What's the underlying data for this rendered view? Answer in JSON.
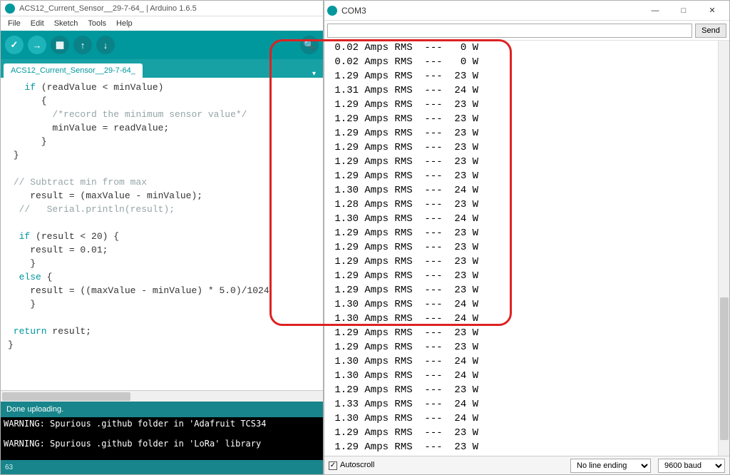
{
  "ide": {
    "title": "ACS12_Current_Sensor__29-7-64_ | Arduino 1.6.5",
    "menu": [
      "File",
      "Edit",
      "Sketch",
      "Tools",
      "Help"
    ],
    "tab": "ACS12_Current_Sensor__29-7-64_",
    "code": {
      "l1a": "   if",
      "l1b": " (readValue < minValue)",
      "l2": "      {",
      "l3a": "        ",
      "l3b": "/*record the minimum sensor value*/",
      "l4": "        minValue = readValue;",
      "l5": "      }",
      "l6": " }",
      "l7": "",
      "l8a": " ",
      "l8b": "// Subtract min from max",
      "l9": "    result = (maxValue - minValue);",
      "l10a": "  ",
      "l10b": "//   Serial.println(result);",
      "l11": "",
      "l12a": "  if",
      "l12b": " (result < 20) {",
      "l13": "    result = 0.01;",
      "l14": "    }",
      "l15a": "  else",
      "l15b": " {",
      "l16": "    result = ((maxValue - minValue) * 5.0)/1024",
      "l17": "    }",
      "l18": "",
      "l19a": " return",
      "l19b": " result;",
      "l20": "}"
    },
    "status": "Done uploading.",
    "console_l1": "WARNING: Spurious .github folder in 'Adafruit TCS34",
    "console_l2": "",
    "console_l3": "WARNING: Spurious .github folder in 'LoRa' library",
    "footer": "63"
  },
  "serial": {
    "port": "COM3",
    "send": "Send",
    "input_value": "",
    "autoscroll": "Autoscroll",
    "line_ending": "No line ending",
    "baud": "9600 baud",
    "lines": [
      " 0.02 Amps RMS  ---   0 W",
      " 0.02 Amps RMS  ---   0 W",
      " 1.29 Amps RMS  ---  23 W",
      " 1.31 Amps RMS  ---  24 W",
      " 1.29 Amps RMS  ---  23 W",
      " 1.29 Amps RMS  ---  23 W",
      " 1.29 Amps RMS  ---  23 W",
      " 1.29 Amps RMS  ---  23 W",
      " 1.29 Amps RMS  ---  23 W",
      " 1.29 Amps RMS  ---  23 W",
      " 1.30 Amps RMS  ---  24 W",
      " 1.28 Amps RMS  ---  23 W",
      " 1.30 Amps RMS  ---  24 W",
      " 1.29 Amps RMS  ---  23 W",
      " 1.29 Amps RMS  ---  23 W",
      " 1.29 Amps RMS  ---  23 W",
      " 1.29 Amps RMS  ---  23 W",
      " 1.29 Amps RMS  ---  23 W",
      " 1.30 Amps RMS  ---  24 W",
      " 1.30 Amps RMS  ---  24 W",
      " 1.29 Amps RMS  ---  23 W",
      " 1.29 Amps RMS  ---  23 W",
      " 1.30 Amps RMS  ---  24 W",
      " 1.30 Amps RMS  ---  24 W",
      " 1.29 Amps RMS  ---  23 W",
      " 1.33 Amps RMS  ---  24 W",
      " 1.30 Amps RMS  ---  24 W",
      " 1.29 Amps RMS  ---  23 W",
      " 1.29 Amps RMS  ---  23 W"
    ]
  },
  "icons": {
    "verify": "✓",
    "upload": "→",
    "new": "▦",
    "open": "↑",
    "save": "↓",
    "monitor": "🔍",
    "min": "—",
    "max": "□",
    "close": "✕",
    "check": "✓",
    "dd": "▾"
  }
}
